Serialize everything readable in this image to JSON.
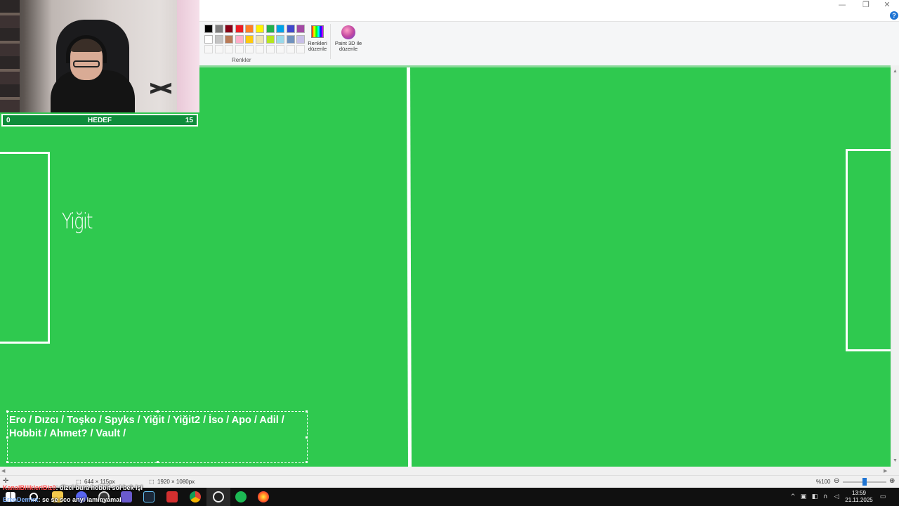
{
  "app": {
    "window_controls": {
      "minimize": "—",
      "restore": "❐",
      "close": "✕",
      "help": "?"
    }
  },
  "ribbon": {
    "group_label": "Renkler",
    "edit_colors_label": "Renkleri düzenle",
    "paint3d_label": "Paint 3D ile düzenle",
    "palette_row1": [
      "#000000",
      "#7f7f7f",
      "#880015",
      "#ed1c24",
      "#ff7f27",
      "#fff200",
      "#22b14c",
      "#00a2e8",
      "#3f48cc",
      "#a349a4"
    ],
    "palette_row2": [
      "#ffffff",
      "#c3c3c3",
      "#b97a57",
      "#ffaec9",
      "#ffc90e",
      "#efe4b0",
      "#b5e61d",
      "#99d9ea",
      "#7092be",
      "#c8bfe7"
    ]
  },
  "scoreboard": {
    "left_score": "0",
    "title": "HEDEF",
    "right_score": "15"
  },
  "canvas": {
    "background": "#2fc94f",
    "player_label": "Yiğit",
    "roster_text": "Ero / Dızcı / Toşko / Spyks / Yiğit / Yiğit2 / İso / Apo / Adil / Hobbit / Ahmet? / Vault /"
  },
  "statusbar": {
    "selection_size": "644 × 115px",
    "image_size": "1920 × 1080px",
    "zoom": "%100"
  },
  "chat": {
    "line1_user": "KanalBilikleriBiz0",
    "line1_msg": ": dizci bura hobbit sol bek işi",
    "line2_user": "ErenDemirx",
    "line2_msg": ": se se sco anyi laminyamal"
  },
  "taskbar": {
    "time": "13:59",
    "date": "21.11.2025"
  }
}
